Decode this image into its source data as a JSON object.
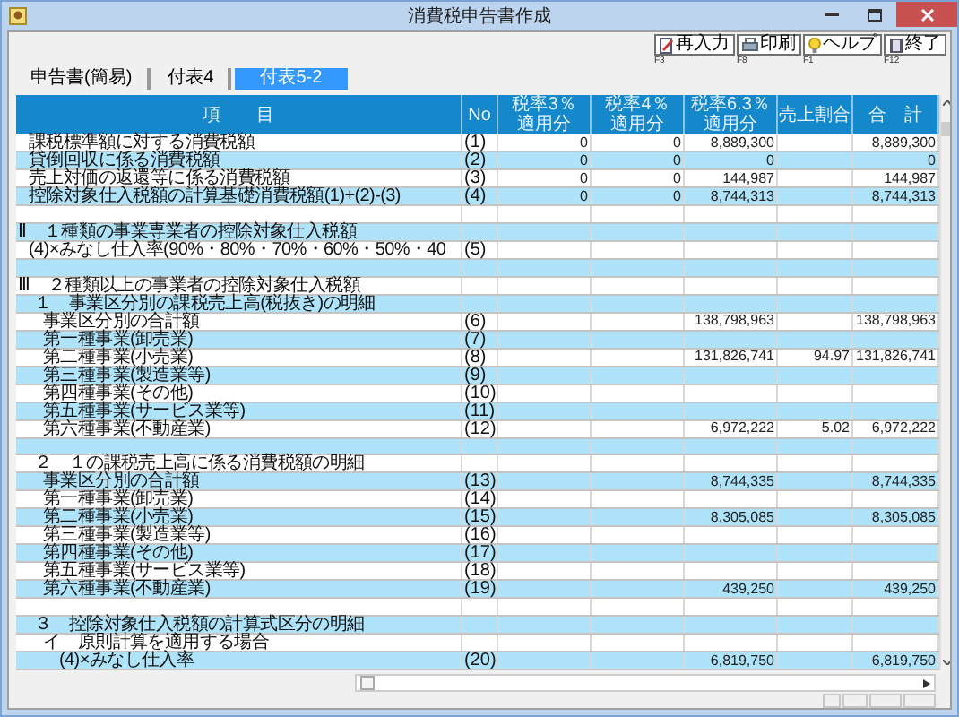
{
  "window": {
    "title": "消費税申告書作成"
  },
  "toolbar": [
    {
      "kind": "reenter",
      "label": "再入力",
      "key": "F3"
    },
    {
      "kind": "print",
      "label": "印刷",
      "key": "F8"
    },
    {
      "kind": "help",
      "label": "ヘルプ",
      "key": "F1"
    },
    {
      "kind": "exit",
      "label": "終了",
      "key": "F12"
    }
  ],
  "tabs": [
    {
      "label": "申告書(簡易)",
      "selected": false
    },
    {
      "label": "付表4",
      "selected": false
    },
    {
      "label": "付表5-2",
      "selected": true
    }
  ],
  "table": {
    "columns": [
      "項　　目",
      "No",
      "税率3％適用分",
      "税率4％適用分",
      "税率6.3％適用分",
      "売上割合",
      "合　計"
    ],
    "rows": [
      {
        "kind": "line",
        "item": "課税標準額に対する消費税額",
        "no": "(1)",
        "rate_3": "0",
        "rate_4": "0",
        "rate_6_3": "8,889,300",
        "total": "8,889,300"
      },
      {
        "kind": "line",
        "item": "貸倒回収に係る消費税額",
        "no": "(2)",
        "rate_3": "0",
        "rate_4": "0",
        "rate_6_3": "0",
        "total": "0"
      },
      {
        "kind": "line",
        "item": "売上対価の返還等に係る消費税額",
        "no": "(3)",
        "rate_3": "0",
        "rate_4": "0",
        "rate_6_3": "144,987",
        "total": "144,987"
      },
      {
        "kind": "line",
        "item": "控除対象仕入税額の計算基礎消費税額(1)+(2)-(3)",
        "no": "(4)",
        "rate_3": "0",
        "rate_4": "0",
        "rate_6_3": "8,744,313",
        "total": "8,744,313"
      },
      {
        "kind": "blank"
      },
      {
        "kind": "section",
        "item": "Ⅱ　１種類の事業専業者の控除対象仕入税額"
      },
      {
        "kind": "line",
        "item": "(4)×みなし仕入率(90%・80%・70%・60%・50%・40",
        "no": "(5)"
      },
      {
        "kind": "blank"
      },
      {
        "kind": "section",
        "item": "Ⅲ　２種類以上の事業者の控除対象仕入税額"
      },
      {
        "kind": "group",
        "item": "１　事業区分別の課税売上高(税抜き)の明細"
      },
      {
        "kind": "item",
        "item": "事業区分別の合計額",
        "no": "(6)",
        "rate_6_3": "138,798,963",
        "total": "138,798,963"
      },
      {
        "kind": "item",
        "item": "第一種事業(卸売業)",
        "no": "(7)"
      },
      {
        "kind": "item",
        "item": "第二種事業(小売業)",
        "no": "(8)",
        "rate_6_3": "131,826,741",
        "sales_ratio": "94.97",
        "total": "131,826,741"
      },
      {
        "kind": "item",
        "item": "第三種事業(製造業等)",
        "no": "(9)"
      },
      {
        "kind": "item",
        "item": "第四種事業(その他)",
        "no": "(10)"
      },
      {
        "kind": "item",
        "item": "第五種事業(サービス業等)",
        "no": "(11)"
      },
      {
        "kind": "item",
        "item": "第六種事業(不動産業)",
        "no": "(12)",
        "rate_6_3": "6,972,222",
        "sales_ratio": "5.02",
        "total": "6,972,222"
      },
      {
        "kind": "blank"
      },
      {
        "kind": "group",
        "item": "２　１の課税売上高に係る消費税額の明細"
      },
      {
        "kind": "item",
        "item": "事業区分別の合計額",
        "no": "(13)",
        "rate_6_3": "8,744,335",
        "total": "8,744,335"
      },
      {
        "kind": "item",
        "item": "第一種事業(卸売業)",
        "no": "(14)"
      },
      {
        "kind": "item",
        "item": "第二種事業(小売業)",
        "no": "(15)",
        "rate_6_3": "8,305,085",
        "total": "8,305,085"
      },
      {
        "kind": "item",
        "item": "第三種事業(製造業等)",
        "no": "(16)"
      },
      {
        "kind": "item",
        "item": "第四種事業(その他)",
        "no": "(17)"
      },
      {
        "kind": "item",
        "item": "第五種事業(サービス業等)",
        "no": "(18)"
      },
      {
        "kind": "item",
        "item": "第六種事業(不動産業)",
        "no": "(19)",
        "rate_6_3": "439,250",
        "total": "439,250"
      },
      {
        "kind": "blank"
      },
      {
        "kind": "group",
        "item": "３　控除対象仕入税額の計算式区分の明細"
      },
      {
        "kind": "item",
        "item": "イ　原則計算を適用する場合"
      },
      {
        "kind": "subitem",
        "item": "(4)×みなし仕入率",
        "no": "(20)",
        "rate_6_3": "6,819,750",
        "total": "6,819,750"
      }
    ]
  }
}
